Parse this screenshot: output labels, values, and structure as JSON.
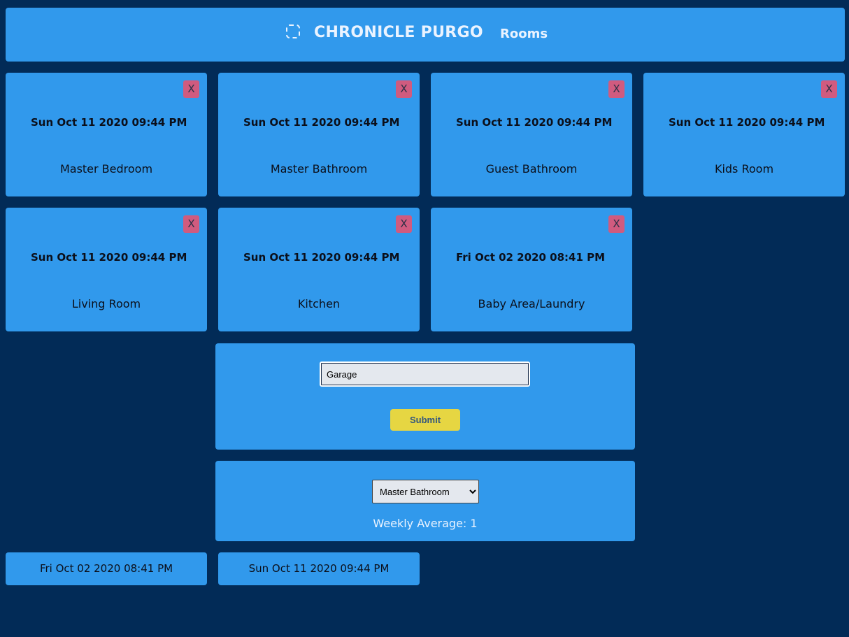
{
  "header": {
    "brand": "CHRONICLE PURGO",
    "nav_rooms": "Rooms",
    "logo_icon": "dashed-square-icon"
  },
  "rooms": [
    {
      "timestamp": "Sun Oct 11 2020 09:44 PM",
      "name": "Master Bedroom",
      "close_label": "X"
    },
    {
      "timestamp": "Sun Oct 11 2020 09:44 PM",
      "name": "Master Bathroom",
      "close_label": "X"
    },
    {
      "timestamp": "Sun Oct 11 2020 09:44 PM",
      "name": "Guest Bathroom",
      "close_label": "X"
    },
    {
      "timestamp": "Sun Oct 11 2020 09:44 PM",
      "name": "Kids Room",
      "close_label": "X"
    },
    {
      "timestamp": "Sun Oct 11 2020 09:44 PM",
      "name": "Living Room",
      "close_label": "X"
    },
    {
      "timestamp": "Sun Oct 11 2020 09:44 PM",
      "name": "Kitchen",
      "close_label": "X"
    },
    {
      "timestamp": "Fri Oct 02 2020 08:41 PM",
      "name": "Baby Area/Laundry",
      "close_label": "X"
    }
  ],
  "add_room": {
    "input_value": "Garage",
    "submit_label": "Submit"
  },
  "stats": {
    "selected_room": "Master Bathroom",
    "weekly_average": "Weekly Average: 1"
  },
  "entries": [
    "Fri Oct 02 2020 08:41 PM",
    "Sun Oct 11 2020 09:44 PM"
  ],
  "colors": {
    "background": "#022b57",
    "card": "#3199ec",
    "close_button": "#d05b7f",
    "submit_button": "#e6d642"
  }
}
